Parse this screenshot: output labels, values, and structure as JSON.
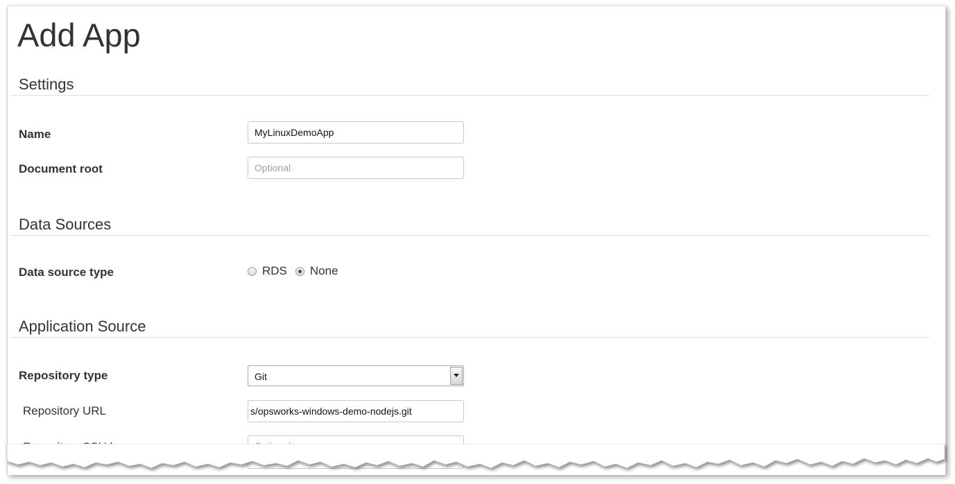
{
  "page": {
    "title": "Add App"
  },
  "settings": {
    "heading": "Settings",
    "name": {
      "label": "Name",
      "value": "MyLinuxDemoApp"
    },
    "document_root": {
      "label": "Document root",
      "placeholder": "Optional"
    }
  },
  "data_sources": {
    "heading": "Data Sources",
    "type_label": "Data source type",
    "options": [
      {
        "label": "RDS",
        "selected": false
      },
      {
        "label": "None",
        "selected": true
      }
    ]
  },
  "application_source": {
    "heading": "Application Source",
    "repository_type": {
      "label": "Repository type",
      "value": "Git"
    },
    "repository_url": {
      "label": "Repository URL",
      "value": "s/opsworks-windows-demo-nodejs.git"
    },
    "repository_ssh_key": {
      "label": "Repository SSH key",
      "placeholder": "Optional"
    }
  }
}
